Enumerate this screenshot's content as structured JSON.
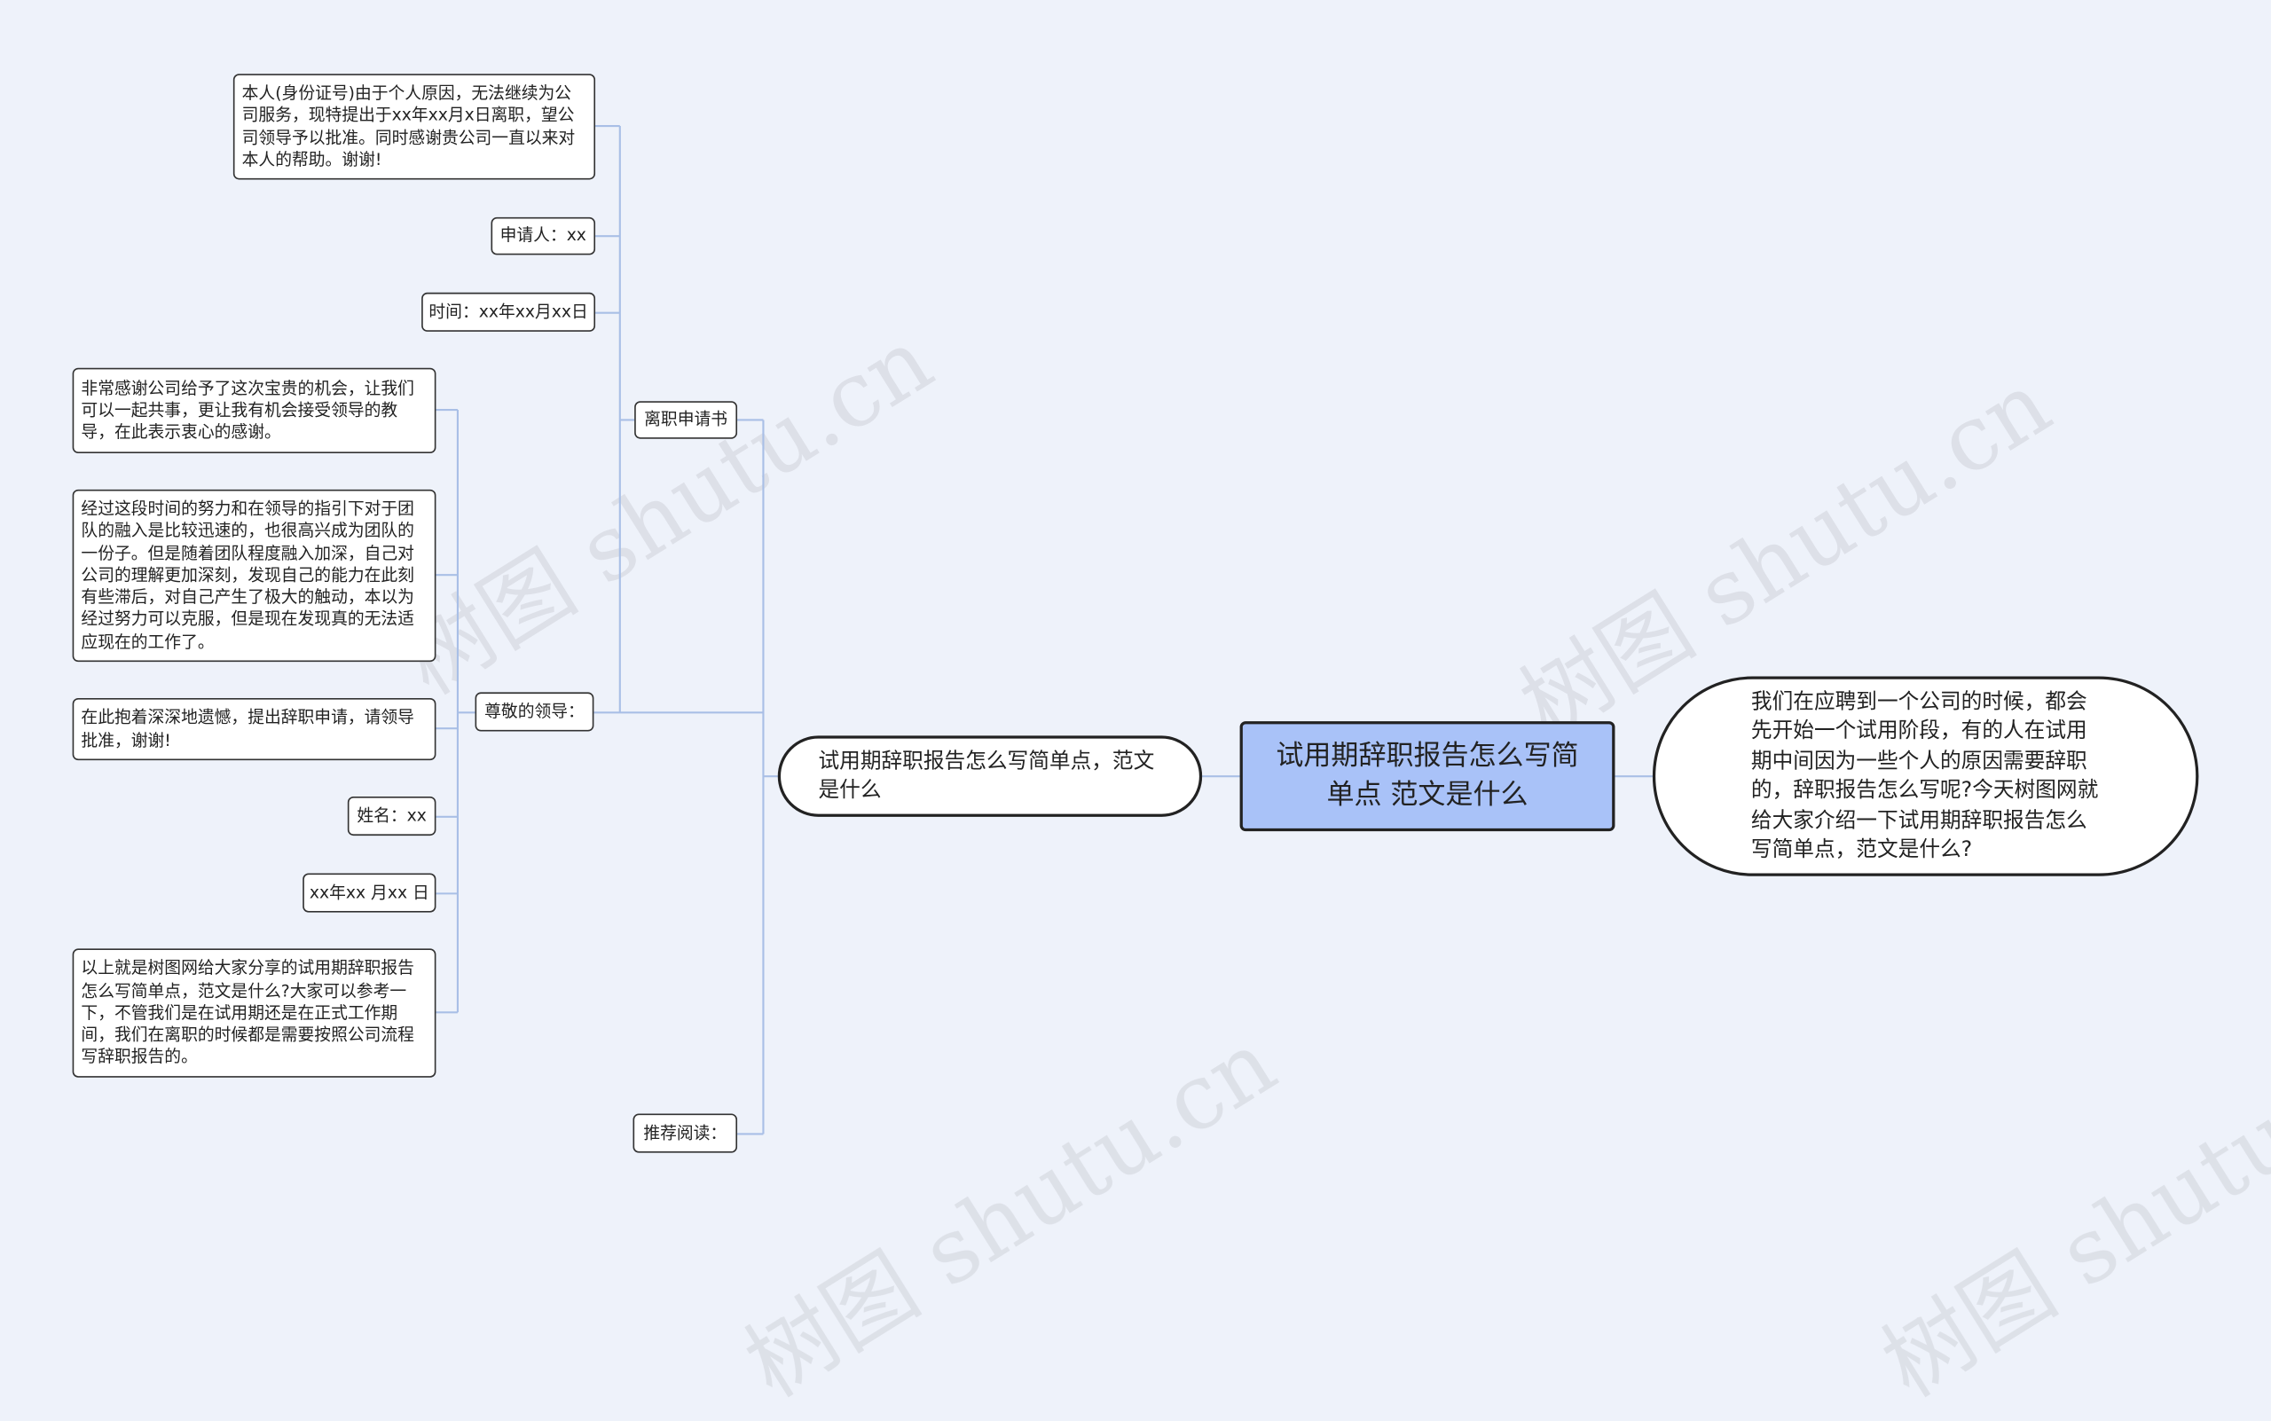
{
  "watermark": "树图 shutu.cn",
  "root": "试用期辞职报告怎么写简单点 范文是什么",
  "right_description": "我们在应聘到一个公司的时候，都会先开始一个试用阶段，有的人在试用期中间因为一些个人的原因需要辞职的，辞职报告怎么写呢?今天树图网就给大家介绍一下试用期辞职报告怎么写简单点，范文是什么?",
  "main_branch": "试用期辞职报告怎么写简单点，范文是什么",
  "branches": {
    "resignation_letter": {
      "label": "离职申请书",
      "children": [
        "本人(身份证号)由于个人原因，无法继续为公司服务，现特提出于xx年xx月x日离职，望公司领导予以批准。同时感谢贵公司一直以来对本人的帮助。谢谢!",
        "申请人：xx",
        "时间：xx年xx月xx日"
      ]
    },
    "dear_leader": {
      "label": "尊敬的领导：",
      "children": [
        "非常感谢公司给予了这次宝贵的机会，让我们可以一起共事，更让我有机会接受领导的教导，在此表示衷心的感谢。",
        "经过这段时间的努力和在领导的指引下对于团队的融入是比较迅速的，也很高兴成为团队的一份子。但是随着团队程度融入加深，自己对公司的理解更加深刻，发现自己的能力在此刻有些滞后，对自己产生了极大的触动，本以为经过努力可以克服，但是现在发现真的无法适应现在的工作了。",
        "在此抱着深深地遗憾，提出辞职申请，请领导批准，谢谢!",
        "姓名：xx",
        "xx年xx 月xx 日",
        "以上就是树图网给大家分享的试用期辞职报告怎么写简单点，范文是什么?大家可以参考一下，不管我们是在试用期还是在正式工作期间，我们在离职的时候都是需要按照公司流程写辞职报告的。"
      ]
    },
    "recommended": {
      "label": "推荐阅读："
    }
  }
}
